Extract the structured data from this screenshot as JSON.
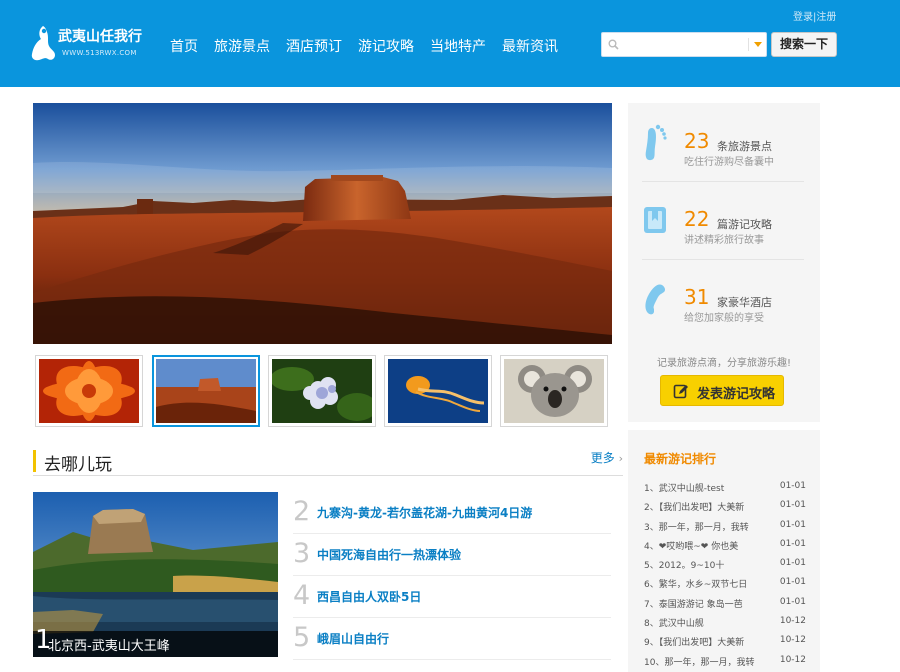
{
  "header": {
    "logo_name": "武夷山任我行",
    "logo_url": "WWW.513RWX.COM",
    "nav": [
      "首页",
      "旅游景点",
      "酒店预订",
      "游记攻略",
      "当地特产",
      "最新资讯"
    ],
    "login": "登录",
    "register": "注册",
    "search_placeholder": "",
    "search_button": "搜索一下"
  },
  "section": {
    "title": "去哪儿玩",
    "more": "更多"
  },
  "feature": {
    "number": "1",
    "caption": "北京西-武夷山大王峰"
  },
  "trips": [
    {
      "num": "2",
      "title": "九寨沟-黄龙-若尔盖花湖-九曲黄河4日游"
    },
    {
      "num": "3",
      "title": "中国死海自由行一热漂体验"
    },
    {
      "num": "4",
      "title": "西昌自由人双卧5日"
    },
    {
      "num": "5",
      "title": "峨眉山自由行"
    }
  ],
  "stats": [
    {
      "num": "23",
      "label": "条旅游景点",
      "desc": "吃住行游购尽备囊中",
      "icon": "footprint-icon"
    },
    {
      "num": "22",
      "label": "篇游记攻略",
      "desc": "讲述精彩旅行故事",
      "icon": "book-icon"
    },
    {
      "num": "31",
      "label": "家豪华酒店",
      "desc": "给您加家般的享受",
      "icon": "phone-icon"
    }
  ],
  "slogan": "记录旅游点滴，分享旅游乐趣!",
  "publish_button": "发表游记攻略",
  "rank": {
    "title": "最新游记排行",
    "items": [
      {
        "text": "1、武汉中山舰-test",
        "date": "01-01"
      },
      {
        "text": "2、【我们出发吧】大美新",
        "date": "01-01"
      },
      {
        "text": "3、那一年，那一月，我转",
        "date": "01-01"
      },
      {
        "text": "4、❤哎哟喂~❤ 你也美",
        "date": "01-01"
      },
      {
        "text": "5、2012。9~10十",
        "date": "01-01"
      },
      {
        "text": "6、繁华，水乡~双节七日",
        "date": "01-01"
      },
      {
        "text": "7、泰国游游记 象岛一芭",
        "date": "01-01"
      },
      {
        "text": "8、武汉中山舰",
        "date": "10-12"
      },
      {
        "text": "9、【我们出发吧】大美新",
        "date": "10-12"
      },
      {
        "text": "10、那一年，那一月，我转",
        "date": "10-12"
      }
    ]
  },
  "colors": {
    "header_bg": "#0a95dd",
    "accent_orange": "#f08a00",
    "link_blue": "#0a7fc4",
    "button_yellow": "#f8d000"
  }
}
